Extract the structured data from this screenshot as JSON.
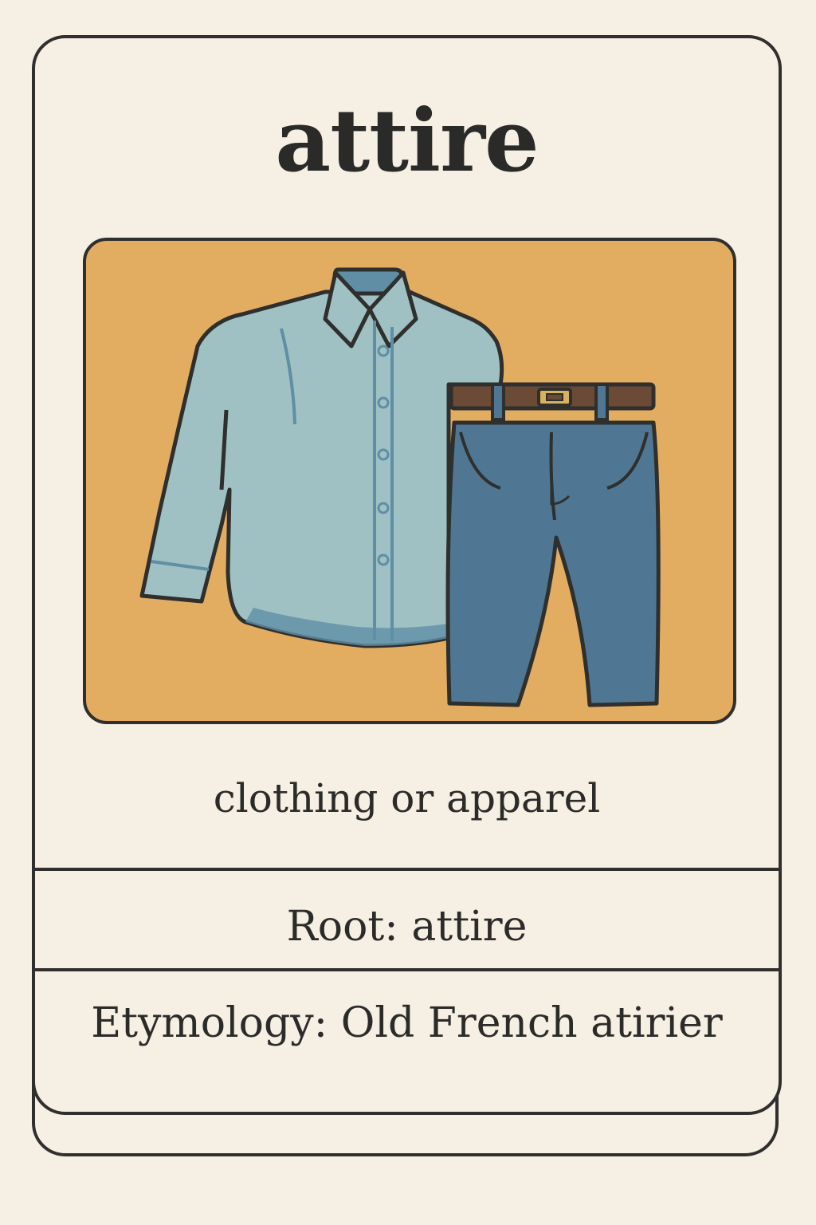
{
  "card": {
    "word": "attire",
    "definition": "clothing or apparel",
    "root": "Root: attire",
    "etymology": "Etymology: Old French atirier"
  },
  "illustration": {
    "icons": [
      "shirt-icon",
      "pants-icon",
      "belt-icon"
    ],
    "colors": {
      "background": "#e3ad61",
      "shirt": "#9fc1c3",
      "shirt_shade": "#5f8ea5",
      "pants": "#4f7793",
      "belt": "#6b4a36",
      "buckle": "#d9b25c",
      "outline": "#2f2f2d"
    }
  },
  "theme": {
    "page_background": "#f6efe4",
    "text": "#2b2b29",
    "border": "#2f2f2d"
  }
}
